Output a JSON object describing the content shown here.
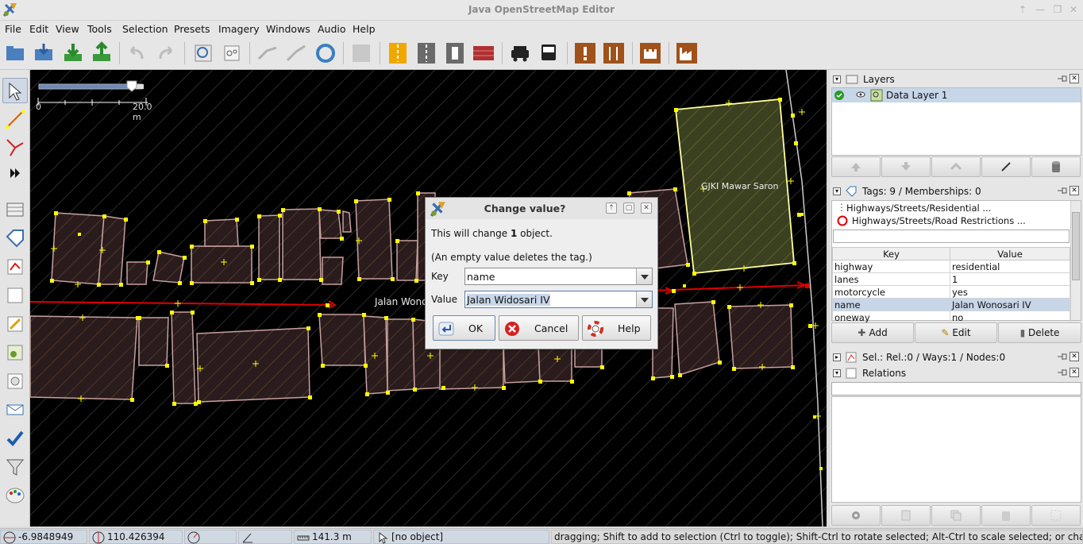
{
  "window": {
    "title": "Java OpenStreetMap Editor"
  },
  "menu": [
    "File",
    "Edit",
    "View",
    "Tools",
    "Selection",
    "Presets",
    "Imagery",
    "Windows",
    "Audio",
    "Help"
  ],
  "map": {
    "scale_start": "0",
    "scale_end": "20.0 m",
    "street_label": "Jalan Wono",
    "building_label": "GJKI Mawar Saron"
  },
  "layers_panel": {
    "title": "Layers",
    "layer_name": "Data Layer 1"
  },
  "tags_panel": {
    "title": "Tags: 9 / Memberships: 0",
    "presets": [
      "Highways/Streets/Residential ...",
      "Highways/Streets/Road Restrictions ..."
    ],
    "col_key": "Key",
    "col_value": "Value",
    "rows": [
      {
        "key": "highway",
        "value": "residential"
      },
      {
        "key": "lanes",
        "value": "1"
      },
      {
        "key": "motorcycle",
        "value": "yes"
      },
      {
        "key": "name",
        "value": "Jalan Wonosari IV"
      },
      {
        "key": "oneway",
        "value": "no"
      }
    ],
    "add_label": "Add",
    "edit_label": "Edit",
    "delete_label": "Delete"
  },
  "selection_panel": {
    "title": "Sel.: Rel.:0 / Ways:1 / Nodes:0"
  },
  "relations_panel": {
    "title": "Relations"
  },
  "dialog": {
    "title": "Change value?",
    "line1_pre": "This will change ",
    "line1_count": "1",
    "line1_post": " object.",
    "line2": "(An empty value deletes the tag.)",
    "key_label": "Key",
    "key_value": "name",
    "value_label": "Value",
    "value_value": "Jalan Widosari IV",
    "ok_label": "OK",
    "cancel_label": "Cancel",
    "help_label": "Help"
  },
  "status": {
    "lat": "-6.9848949",
    "lon": "110.426394",
    "distance": "141.3 m",
    "object": "[no object]",
    "message": "dragging; Shift to add to selection (Ctrl to toggle); Shift-Ctrl to rotate selected; Alt-Ctrl to scale selected; or change selection"
  },
  "colors": {
    "accent": "#c7d6e8",
    "way_red": "#e00000",
    "node_yellow": "#ffff00",
    "building_fill": "#2a1c1c",
    "building_stroke": "#c8a0a0"
  }
}
